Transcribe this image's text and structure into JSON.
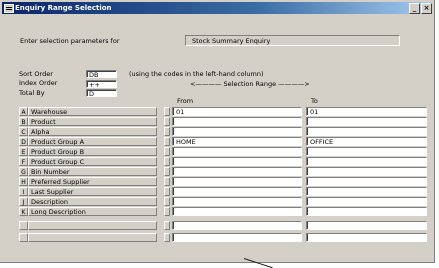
{
  "window": {
    "title": "Enquiry Range Selection",
    "minimize_glyph": "_",
    "close_glyph": "×"
  },
  "params": {
    "label": "Enter selection parameters for",
    "value": "Stock Summary Enquiry"
  },
  "sort": {
    "label": "Sort Order",
    "value": "DB",
    "hint": "(using the codes in the left-hand column)"
  },
  "index": {
    "label": "Index Order",
    "value": "++"
  },
  "total": {
    "label": "Total By",
    "value": "D"
  },
  "range": {
    "header": "<———— Selection Range ————>",
    "from_label": "From",
    "to_label": "To"
  },
  "rows": [
    {
      "code": "A",
      "desc": "Warehouse",
      "from": "01",
      "to": "01"
    },
    {
      "code": "B",
      "desc": "Product",
      "from": "",
      "to": ""
    },
    {
      "code": "C",
      "desc": "Alpha",
      "from": "",
      "to": ""
    },
    {
      "code": "D",
      "desc": "Product Group A",
      "from": "HOME",
      "to": "OFFICE"
    },
    {
      "code": "E",
      "desc": "Product Group B",
      "from": "",
      "to": ""
    },
    {
      "code": "F",
      "desc": "Product Group C",
      "from": "",
      "to": ""
    },
    {
      "code": "G",
      "desc": "Bin Number",
      "from": "",
      "to": ""
    },
    {
      "code": "H",
      "desc": "Preferred Supplier",
      "from": "",
      "to": ""
    },
    {
      "code": "I",
      "desc": "Last Supplier",
      "from": "",
      "to": ""
    },
    {
      "code": "J",
      "desc": "Description",
      "from": "",
      "to": ""
    },
    {
      "code": "K",
      "desc": "Long Description",
      "from": "",
      "to": ""
    },
    {
      "code": "",
      "desc": "",
      "from": "",
      "to": ""
    },
    {
      "code": "",
      "desc": "",
      "from": "",
      "to": ""
    }
  ]
}
